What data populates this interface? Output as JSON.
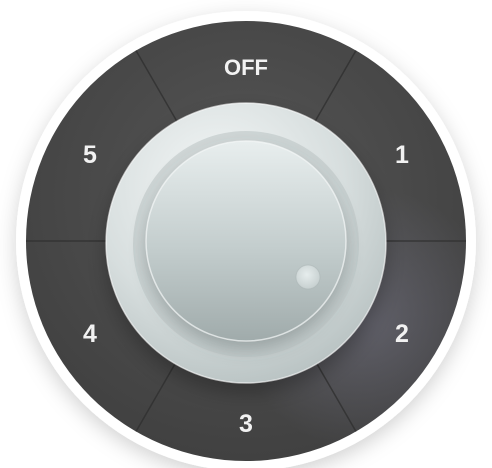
{
  "dial": {
    "positions": [
      {
        "id": "off",
        "label": "OFF"
      },
      {
        "id": "1",
        "label": "1"
      },
      {
        "id": "2",
        "label": "2"
      },
      {
        "id": "3",
        "label": "3"
      },
      {
        "id": "4",
        "label": "4"
      },
      {
        "id": "5",
        "label": "5"
      }
    ],
    "knob_indicator_icon": "indicator-dot"
  },
  "colors": {
    "background": "#ffffff",
    "ring": "#4a4a4a",
    "ring_dark": "#3a3a3a",
    "divider": "#2f2f2f",
    "label": "#f2f2f2",
    "knob_light": "#eef2f2",
    "knob_mid": "#c9d1d1",
    "knob_dark": "#98a3a3"
  }
}
